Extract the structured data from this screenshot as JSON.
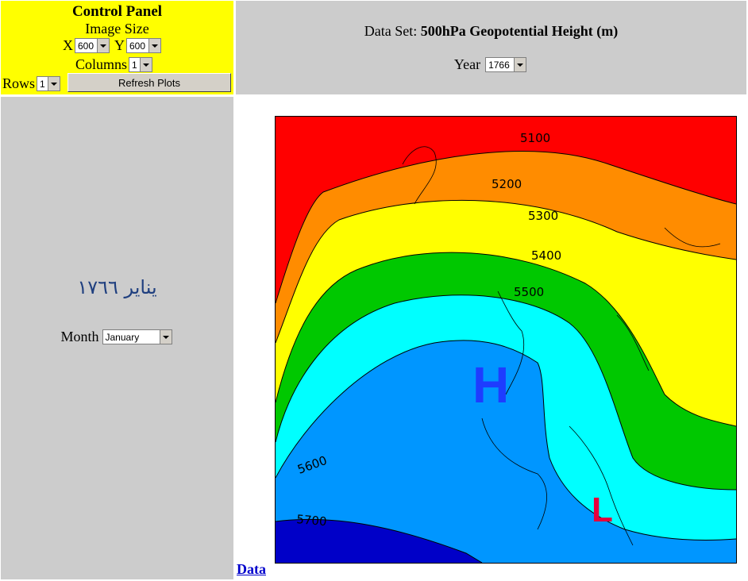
{
  "control_panel": {
    "title": "Control Panel",
    "image_size_label": "Image Size",
    "x_label": "X",
    "x_value": "600",
    "y_label": "Y",
    "y_value": "600",
    "columns_label": "Columns",
    "columns_value": "1",
    "rows_label": "Rows",
    "rows_value": "1",
    "refresh_button": "Refresh Plots"
  },
  "dataset": {
    "prefix": "Data Set:",
    "name": "500hPa Geopotential Height (m)",
    "year_label": "Year",
    "year_value": "1766"
  },
  "month_panel": {
    "arabic_title": "يناير ١٧٦٦",
    "month_label": "Month",
    "month_value": "January"
  },
  "plot": {
    "contour_labels": [
      "5100",
      "5200",
      "5300",
      "5400",
      "5500",
      "5600",
      "5700"
    ],
    "high_marker": "H",
    "low_marker": "L",
    "data_link": "Data"
  },
  "colors": {
    "control_bg": "#ffff00",
    "panel_bg": "#cccccc",
    "band_red": "#ff0000",
    "band_orange": "#ff8c00",
    "band_yellow": "#ffff00",
    "band_green": "#00c800",
    "band_cyan": "#00ffff",
    "band_blue": "#0096ff",
    "band_darkblue": "#0000c8"
  }
}
